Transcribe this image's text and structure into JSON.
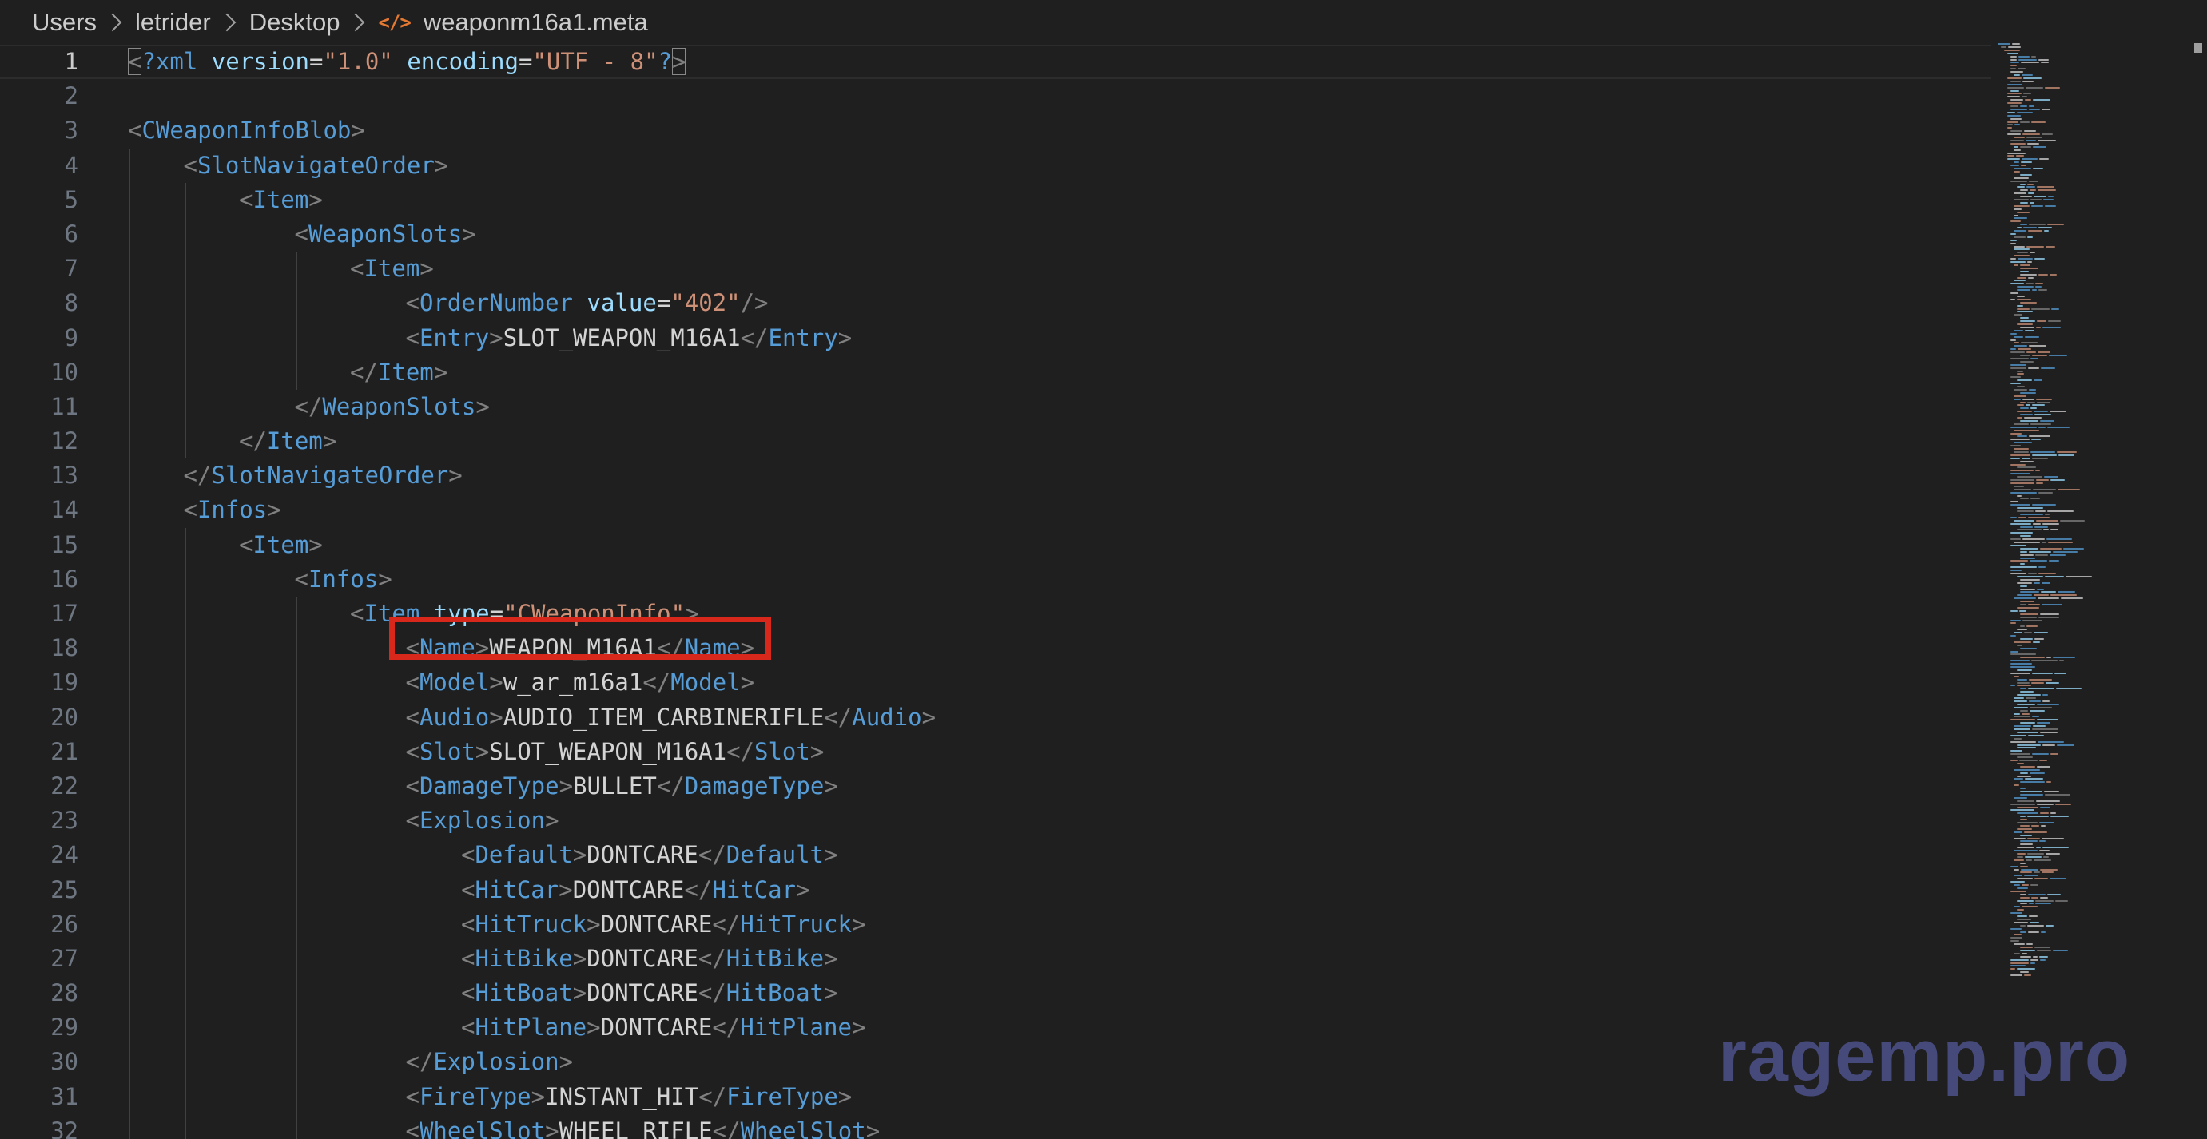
{
  "breadcrumb": {
    "items": [
      "Users",
      "letrider",
      "Desktop"
    ],
    "file_icon": "</>",
    "file_name": "weaponm16a1.meta"
  },
  "editor": {
    "current_line": 1,
    "highlighted_line": 18,
    "lines": [
      {
        "n": "1",
        "indent": 0,
        "tokens": [
          [
            "punc",
            "<"
          ],
          [
            "decl",
            "?xml"
          ],
          [
            "text",
            " "
          ],
          [
            "attr",
            "version"
          ],
          [
            "text",
            "="
          ],
          [
            "str",
            "\"1.0\""
          ],
          [
            "text",
            " "
          ],
          [
            "attr",
            "encoding"
          ],
          [
            "text",
            "="
          ],
          [
            "str",
            "\"UTF - 8\""
          ],
          [
            "decl",
            "?"
          ],
          [
            "punc",
            ">"
          ]
        ]
      },
      {
        "n": "2",
        "indent": 0,
        "tokens": []
      },
      {
        "n": "3",
        "indent": 0,
        "tokens": [
          [
            "punc",
            "<"
          ],
          [
            "tag",
            "CWeaponInfoBlob"
          ],
          [
            "punc",
            ">"
          ]
        ]
      },
      {
        "n": "4",
        "indent": 1,
        "tokens": [
          [
            "punc",
            "<"
          ],
          [
            "tag",
            "SlotNavigateOrder"
          ],
          [
            "punc",
            ">"
          ]
        ]
      },
      {
        "n": "5",
        "indent": 2,
        "tokens": [
          [
            "punc",
            "<"
          ],
          [
            "tag",
            "Item"
          ],
          [
            "punc",
            ">"
          ]
        ]
      },
      {
        "n": "6",
        "indent": 3,
        "tokens": [
          [
            "punc",
            "<"
          ],
          [
            "tag",
            "WeaponSlots"
          ],
          [
            "punc",
            ">"
          ]
        ]
      },
      {
        "n": "7",
        "indent": 4,
        "tokens": [
          [
            "punc",
            "<"
          ],
          [
            "tag",
            "Item"
          ],
          [
            "punc",
            ">"
          ]
        ]
      },
      {
        "n": "8",
        "indent": 5,
        "tokens": [
          [
            "punc",
            "<"
          ],
          [
            "tag",
            "OrderNumber"
          ],
          [
            "text",
            " "
          ],
          [
            "attr",
            "value"
          ],
          [
            "text",
            "="
          ],
          [
            "str",
            "\"402\""
          ],
          [
            "punc",
            "/>"
          ]
        ]
      },
      {
        "n": "9",
        "indent": 5,
        "tokens": [
          [
            "punc",
            "<"
          ],
          [
            "tag",
            "Entry"
          ],
          [
            "punc",
            ">"
          ],
          [
            "text",
            "SLOT_WEAPON_M16A1"
          ],
          [
            "punc",
            "</"
          ],
          [
            "tag",
            "Entry"
          ],
          [
            "punc",
            ">"
          ]
        ]
      },
      {
        "n": "10",
        "indent": 4,
        "tokens": [
          [
            "punc",
            "</"
          ],
          [
            "tag",
            "Item"
          ],
          [
            "punc",
            ">"
          ]
        ]
      },
      {
        "n": "11",
        "indent": 3,
        "tokens": [
          [
            "punc",
            "</"
          ],
          [
            "tag",
            "WeaponSlots"
          ],
          [
            "punc",
            ">"
          ]
        ]
      },
      {
        "n": "12",
        "indent": 2,
        "tokens": [
          [
            "punc",
            "</"
          ],
          [
            "tag",
            "Item"
          ],
          [
            "punc",
            ">"
          ]
        ]
      },
      {
        "n": "13",
        "indent": 1,
        "tokens": [
          [
            "punc",
            "</"
          ],
          [
            "tag",
            "SlotNavigateOrder"
          ],
          [
            "punc",
            ">"
          ]
        ]
      },
      {
        "n": "14",
        "indent": 1,
        "tokens": [
          [
            "punc",
            "<"
          ],
          [
            "tag",
            "Infos"
          ],
          [
            "punc",
            ">"
          ]
        ]
      },
      {
        "n": "15",
        "indent": 2,
        "tokens": [
          [
            "punc",
            "<"
          ],
          [
            "tag",
            "Item"
          ],
          [
            "punc",
            ">"
          ]
        ]
      },
      {
        "n": "16",
        "indent": 3,
        "tokens": [
          [
            "punc",
            "<"
          ],
          [
            "tag",
            "Infos"
          ],
          [
            "punc",
            ">"
          ]
        ]
      },
      {
        "n": "17",
        "indent": 4,
        "tokens": [
          [
            "punc",
            "<"
          ],
          [
            "tag",
            "Item"
          ],
          [
            "text",
            " "
          ],
          [
            "attr",
            "type"
          ],
          [
            "text",
            "="
          ],
          [
            "str",
            "\"CWeaponInfo\""
          ],
          [
            "punc",
            ">"
          ]
        ]
      },
      {
        "n": "18",
        "indent": 5,
        "tokens": [
          [
            "punc",
            "<"
          ],
          [
            "tag",
            "Name"
          ],
          [
            "punc",
            ">"
          ],
          [
            "text",
            "WEAPON_M16A1"
          ],
          [
            "punc",
            "</"
          ],
          [
            "tag",
            "Name"
          ],
          [
            "punc",
            ">"
          ]
        ]
      },
      {
        "n": "19",
        "indent": 5,
        "tokens": [
          [
            "punc",
            "<"
          ],
          [
            "tag",
            "Model"
          ],
          [
            "punc",
            ">"
          ],
          [
            "text",
            "w_ar_m16a1"
          ],
          [
            "punc",
            "</"
          ],
          [
            "tag",
            "Model"
          ],
          [
            "punc",
            ">"
          ]
        ]
      },
      {
        "n": "20",
        "indent": 5,
        "tokens": [
          [
            "punc",
            "<"
          ],
          [
            "tag",
            "Audio"
          ],
          [
            "punc",
            ">"
          ],
          [
            "text",
            "AUDIO_ITEM_CARBINERIFLE"
          ],
          [
            "punc",
            "</"
          ],
          [
            "tag",
            "Audio"
          ],
          [
            "punc",
            ">"
          ]
        ]
      },
      {
        "n": "21",
        "indent": 5,
        "tokens": [
          [
            "punc",
            "<"
          ],
          [
            "tag",
            "Slot"
          ],
          [
            "punc",
            ">"
          ],
          [
            "text",
            "SLOT_WEAPON_M16A1"
          ],
          [
            "punc",
            "</"
          ],
          [
            "tag",
            "Slot"
          ],
          [
            "punc",
            ">"
          ]
        ]
      },
      {
        "n": "22",
        "indent": 5,
        "tokens": [
          [
            "punc",
            "<"
          ],
          [
            "tag",
            "DamageType"
          ],
          [
            "punc",
            ">"
          ],
          [
            "text",
            "BULLET"
          ],
          [
            "punc",
            "</"
          ],
          [
            "tag",
            "DamageType"
          ],
          [
            "punc",
            ">"
          ]
        ]
      },
      {
        "n": "23",
        "indent": 5,
        "tokens": [
          [
            "punc",
            "<"
          ],
          [
            "tag",
            "Explosion"
          ],
          [
            "punc",
            ">"
          ]
        ]
      },
      {
        "n": "24",
        "indent": 6,
        "tokens": [
          [
            "punc",
            "<"
          ],
          [
            "tag",
            "Default"
          ],
          [
            "punc",
            ">"
          ],
          [
            "text",
            "DONTCARE"
          ],
          [
            "punc",
            "</"
          ],
          [
            "tag",
            "Default"
          ],
          [
            "punc",
            ">"
          ]
        ]
      },
      {
        "n": "25",
        "indent": 6,
        "tokens": [
          [
            "punc",
            "<"
          ],
          [
            "tag",
            "HitCar"
          ],
          [
            "punc",
            ">"
          ],
          [
            "text",
            "DONTCARE"
          ],
          [
            "punc",
            "</"
          ],
          [
            "tag",
            "HitCar"
          ],
          [
            "punc",
            ">"
          ]
        ]
      },
      {
        "n": "26",
        "indent": 6,
        "tokens": [
          [
            "punc",
            "<"
          ],
          [
            "tag",
            "HitTruck"
          ],
          [
            "punc",
            ">"
          ],
          [
            "text",
            "DONTCARE"
          ],
          [
            "punc",
            "</"
          ],
          [
            "tag",
            "HitTruck"
          ],
          [
            "punc",
            ">"
          ]
        ]
      },
      {
        "n": "27",
        "indent": 6,
        "tokens": [
          [
            "punc",
            "<"
          ],
          [
            "tag",
            "HitBike"
          ],
          [
            "punc",
            ">"
          ],
          [
            "text",
            "DONTCARE"
          ],
          [
            "punc",
            "</"
          ],
          [
            "tag",
            "HitBike"
          ],
          [
            "punc",
            ">"
          ]
        ]
      },
      {
        "n": "28",
        "indent": 6,
        "tokens": [
          [
            "punc",
            "<"
          ],
          [
            "tag",
            "HitBoat"
          ],
          [
            "punc",
            ">"
          ],
          [
            "text",
            "DONTCARE"
          ],
          [
            "punc",
            "</"
          ],
          [
            "tag",
            "HitBoat"
          ],
          [
            "punc",
            ">"
          ]
        ]
      },
      {
        "n": "29",
        "indent": 6,
        "tokens": [
          [
            "punc",
            "<"
          ],
          [
            "tag",
            "HitPlane"
          ],
          [
            "punc",
            ">"
          ],
          [
            "text",
            "DONTCARE"
          ],
          [
            "punc",
            "</"
          ],
          [
            "tag",
            "HitPlane"
          ],
          [
            "punc",
            ">"
          ]
        ]
      },
      {
        "n": "30",
        "indent": 5,
        "tokens": [
          [
            "punc",
            "</"
          ],
          [
            "tag",
            "Explosion"
          ],
          [
            "punc",
            ">"
          ]
        ]
      },
      {
        "n": "31",
        "indent": 5,
        "tokens": [
          [
            "punc",
            "<"
          ],
          [
            "tag",
            "FireType"
          ],
          [
            "punc",
            ">"
          ],
          [
            "text",
            "INSTANT_HIT"
          ],
          [
            "punc",
            "</"
          ],
          [
            "tag",
            "FireType"
          ],
          [
            "punc",
            ">"
          ]
        ]
      },
      {
        "n": "32",
        "indent": 5,
        "tokens": [
          [
            "punc",
            "<"
          ],
          [
            "tag",
            "WheelSlot"
          ],
          [
            "punc",
            ">"
          ],
          [
            "text",
            "WHEEL_RIFLE"
          ],
          [
            "punc",
            "</"
          ],
          [
            "tag",
            "WheelSlot"
          ],
          [
            "punc",
            ">"
          ]
        ]
      }
    ]
  },
  "colors": {
    "background": "#1f1f1f",
    "tag": "#569cd6",
    "punctuation": "#808080",
    "attribute": "#9cdcfe",
    "string": "#ce9178",
    "text": "#d4d4d4",
    "line_number": "#6e7681",
    "highlight_box": "#d8281c",
    "watermark": "#4b4f86"
  },
  "watermark": {
    "text": "ragemp.pro"
  }
}
